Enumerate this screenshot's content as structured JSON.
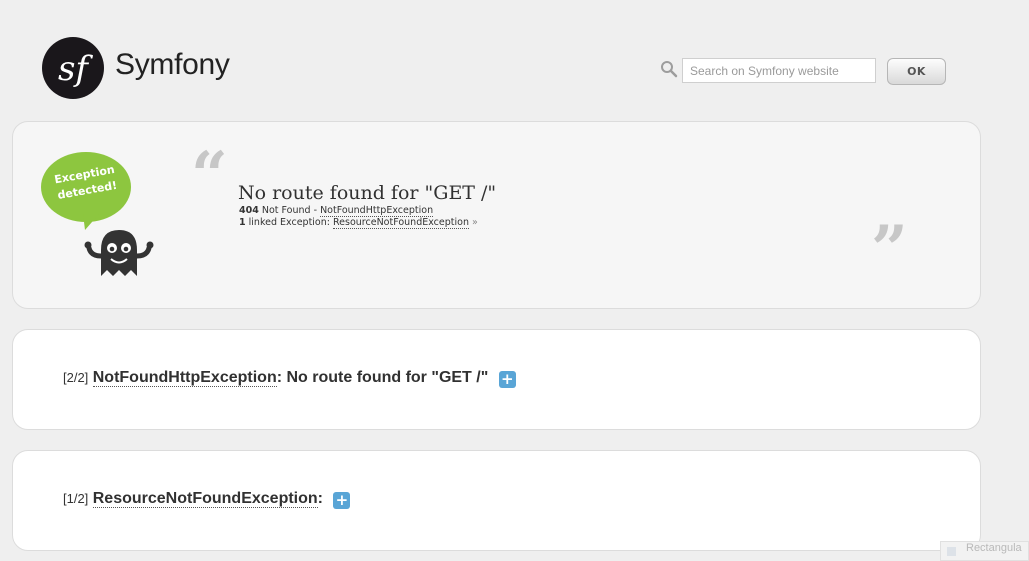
{
  "header": {
    "brand": "Symfony",
    "logo_icon": "symfony-sf-logo",
    "search": {
      "placeholder": "Search on Symfony website",
      "value": ""
    },
    "ok_label": "OK"
  },
  "exception": {
    "bubble_line1": "Exception",
    "bubble_line2": "detected!",
    "title": "No route found for \"GET /\"",
    "status_code": "404",
    "status_text": "Not Found",
    "separator": "-",
    "exception_class": "NotFoundHttpException",
    "linked_count": "1",
    "linked_label": "linked Exception:",
    "linked_class": "ResourceNotFoundException",
    "linked_suffix": "»"
  },
  "traces": [
    {
      "position": "[2/2]",
      "class": "NotFoundHttpException",
      "message": ": No route found for \"GET /\"",
      "toggle": "+"
    },
    {
      "position": "[1/2]",
      "class": "ResourceNotFoundException",
      "message": ":",
      "toggle": "+"
    }
  ],
  "overlay": {
    "label": "Rectangula"
  },
  "colors": {
    "accent_green": "#8dc63f",
    "toggle_blue": "#59a5d6",
    "logo_dark": "#1a171b"
  }
}
